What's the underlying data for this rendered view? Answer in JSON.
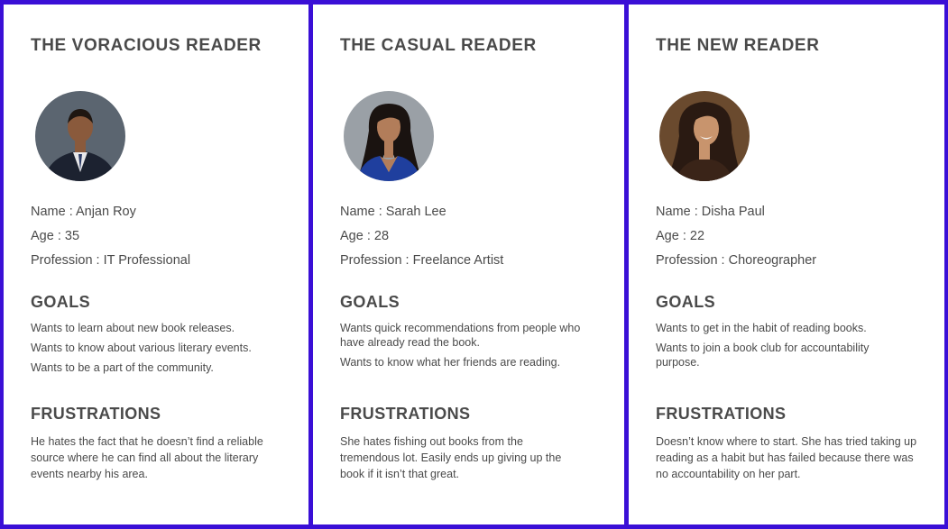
{
  "personas": [
    {
      "title": "THE VORACIOUS READER",
      "name_line": "Name : Anjan Roy",
      "age_line": "Age : 35",
      "profession_line": "Profession : IT Professional",
      "goals_heading": "GOALS",
      "goals": [
        "Wants to learn about new book releases.",
        "Wants to know about various literary events.",
        "Wants to be a part of the community."
      ],
      "frustrations_heading": "FRUSTRATIONS",
      "frustrations": "He hates the fact that he doesn’t find a reliable source where he can find all about the literary events nearby his area.",
      "photo_bg": "#5b6570",
      "photo_skin": "#8a5a3c",
      "photo_hair": "#1e1611",
      "photo_clothes": "#1c2230",
      "photo_icon": "man-in-suit-photo"
    },
    {
      "title": "THE CASUAL READER",
      "name_line": "Name : Sarah Lee",
      "age_line": "Age : 28",
      "profession_line": "Profession : Freelance Artist",
      "goals_heading": "GOALS",
      "goals": [
        "Wants quick recommendations from people who have already read the book.",
        "Wants to know what her friends are reading."
      ],
      "frustrations_heading": "FRUSTRATIONS",
      "frustrations": "She hates fishing out books from the tremendous lot. Easily ends up giving up the book if it isn’t that great.",
      "photo_bg": "#9aa0a6",
      "photo_skin": "#b27d5a",
      "photo_hair": "#1a1310",
      "photo_clothes": "#1f3f9e",
      "photo_icon": "woman-blue-top-photo"
    },
    {
      "title": "THE NEW READER",
      "name_line": "Name : Disha Paul",
      "age_line": "Age : 22",
      "profession_line": "Profession : Choreographer",
      "goals_heading": "GOALS",
      "goals": [
        "Wants to get in the habit of reading books.",
        "Wants to join a book club for accountability purpose."
      ],
      "frustrations_heading": "FRUSTRATIONS",
      "frustrations": "Doesn’t know where to start. She has tried taking up reading as a habit but has failed because there was no accountability on her part.",
      "photo_bg": "#6a4a2e",
      "photo_skin": "#c8946d",
      "photo_hair": "#2a1a12",
      "photo_clothes": "#3a2418",
      "photo_icon": "smiling-woman-photo"
    }
  ]
}
